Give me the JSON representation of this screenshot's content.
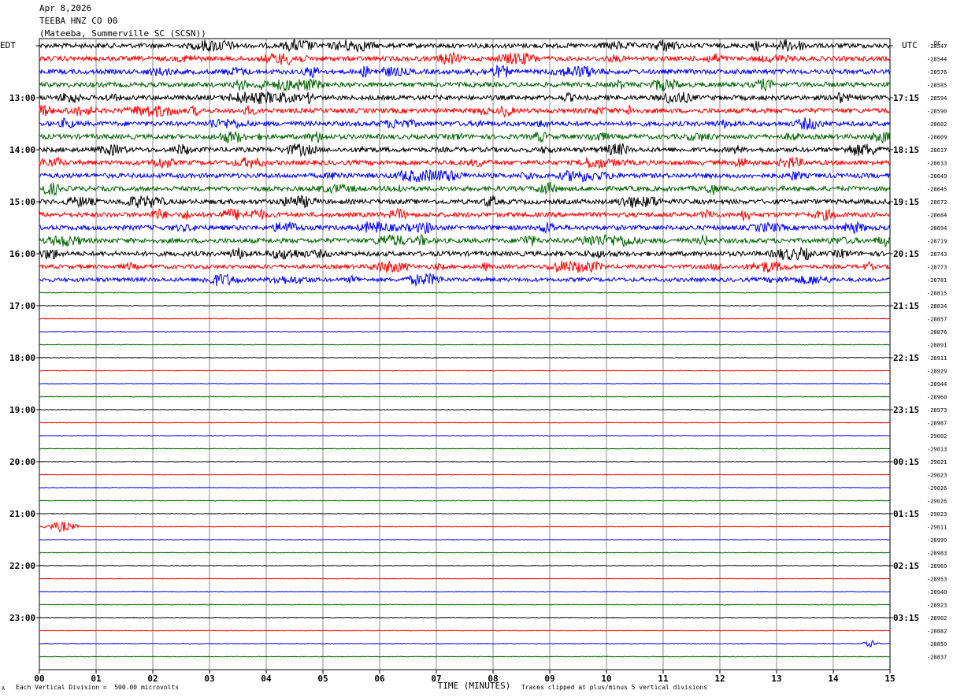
{
  "header": {
    "date": "Apr 8,2026",
    "channel": "TEEBA HNZ CO 00",
    "station": "(Mateeba, Summerville SC (SCSN))"
  },
  "labels": {
    "left_tz": "EDT",
    "right_tz": "UTC",
    "dc_tag": "DC",
    "xlabel": "TIME (MINUTES)",
    "scale_note": "Each Vertical Division =  500.00 microvolts",
    "clip_note": "Traces clipped at plus/minus 5 vertical divisions",
    "corner_mark": "A"
  },
  "colors": [
    "#000000",
    "#ff0000",
    "#0000ff",
    "#006600"
  ],
  "chart_data": {
    "type": "line",
    "title": "TEEBA HNZ CO 00",
    "xlabel": "TIME (MINUTES)",
    "xlim": [
      0,
      15
    ],
    "x_ticks": [
      "00",
      "01",
      "02",
      "03",
      "04",
      "05",
      "06",
      "07",
      "08",
      "09",
      "10",
      "11",
      "12",
      "13",
      "14",
      "15"
    ],
    "grid": true,
    "left_hour_labels": [
      "13:00",
      "14:00",
      "15:00",
      "16:00",
      "17:00",
      "18:00",
      "19:00",
      "20:00",
      "21:00",
      "22:00",
      "23:00"
    ],
    "right_hour_labels": [
      "17:15",
      "18:15",
      "19:15",
      "20:15",
      "21:15",
      "22:15",
      "23:15",
      "00:15",
      "01:15",
      "02:15",
      "03:15"
    ],
    "dc_offsets": [
      -28547,
      -28544,
      -28576,
      -28585,
      -28594,
      -28590,
      -28602,
      -28609,
      -28617,
      -28633,
      -28649,
      -28645,
      -28672,
      -28684,
      -28694,
      -28719,
      -28743,
      -28773,
      -28781,
      -28815,
      -28834,
      -28857,
      -28876,
      -28891,
      -28911,
      -28929,
      -28944,
      -28960,
      -28973,
      -28987,
      -29002,
      -29013,
      -29021,
      -29023,
      -29026,
      -29026,
      -29023,
      -29011,
      -28999,
      -28983,
      -28969,
      -28953,
      -28940,
      -28923,
      -28902,
      -28882,
      -28859,
      -28837
    ],
    "trace_activity": [
      3,
      3,
      3,
      3,
      3,
      3,
      3,
      3,
      3,
      3,
      3,
      3,
      3,
      3,
      3,
      3,
      3,
      2.5,
      2.5,
      0.5,
      0.4,
      0.4,
      0.4,
      0.4,
      0.4,
      0.4,
      0.4,
      0.4,
      0.4,
      0.4,
      0.4,
      0.4,
      0.4,
      0.4,
      0.4,
      0.4,
      0.4,
      0.4,
      0.4,
      0.4,
      0.4,
      0.4,
      0.4,
      0.4,
      0.4,
      0.4,
      0.4,
      0.4
    ]
  }
}
